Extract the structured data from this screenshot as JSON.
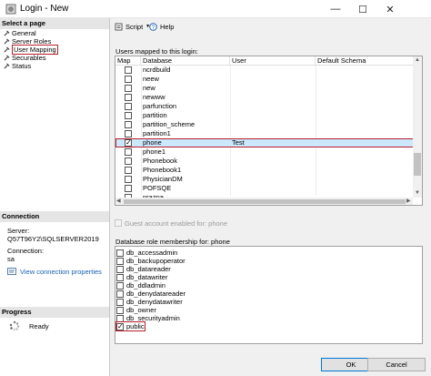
{
  "window": {
    "title": "Login - New",
    "controls": {
      "minimize": "—",
      "maximize": "☐",
      "close": "✕"
    }
  },
  "left": {
    "select_page_header": "Select a page",
    "pages": [
      {
        "label": "General"
      },
      {
        "label": "Server Roles"
      },
      {
        "label": "User Mapping"
      },
      {
        "label": "Securables"
      },
      {
        "label": "Status"
      }
    ],
    "connection_header": "Connection",
    "server_label": "Server:",
    "server_value": "Q57T96Y2\\SQLSERVER2019",
    "connection_label": "Connection:",
    "connection_value": "sa",
    "view_connection_link": "View connection properties",
    "progress_header": "Progress",
    "progress_status": "Ready"
  },
  "toolbar": {
    "script_label": "Script",
    "help_label": "Help"
  },
  "users_mapped": {
    "label": "Users mapped to this login:",
    "columns": [
      "Map",
      "Database",
      "User",
      "Default Schema"
    ],
    "rows": [
      {
        "map": false,
        "database": "ncrdbuild",
        "user": "",
        "schema": ""
      },
      {
        "map": false,
        "database": "neew",
        "user": "",
        "schema": ""
      },
      {
        "map": false,
        "database": "new",
        "user": "",
        "schema": ""
      },
      {
        "map": false,
        "database": "newww",
        "user": "",
        "schema": ""
      },
      {
        "map": false,
        "database": "parfunction",
        "user": "",
        "schema": ""
      },
      {
        "map": false,
        "database": "partition",
        "user": "",
        "schema": ""
      },
      {
        "map": false,
        "database": "partition_scheme",
        "user": "",
        "schema": ""
      },
      {
        "map": false,
        "database": "partition1",
        "user": "",
        "schema": ""
      },
      {
        "map": true,
        "database": "phone",
        "user": "Test",
        "schema": ""
      },
      {
        "map": false,
        "database": "phone1",
        "user": "",
        "schema": ""
      },
      {
        "map": false,
        "database": "Phonebook",
        "user": "",
        "schema": ""
      },
      {
        "map": false,
        "database": "Phonebook1",
        "user": "",
        "schema": ""
      },
      {
        "map": false,
        "database": "PhysicianDM",
        "user": "",
        "schema": ""
      },
      {
        "map": false,
        "database": "POFSQE",
        "user": "",
        "schema": ""
      },
      {
        "map": false,
        "database": "prazna",
        "user": "",
        "schema": ""
      }
    ],
    "selected_row": 8
  },
  "guest": {
    "label": "Guest account enabled for: phone"
  },
  "roles": {
    "label": "Database role membership for: phone",
    "items": [
      {
        "name": "db_accessadmin",
        "checked": false
      },
      {
        "name": "db_backupoperator",
        "checked": false
      },
      {
        "name": "db_datareader",
        "checked": false
      },
      {
        "name": "db_datawriter",
        "checked": false
      },
      {
        "name": "db_ddladmin",
        "checked": false
      },
      {
        "name": "db_denydatareader",
        "checked": false
      },
      {
        "name": "db_denydatawriter",
        "checked": false
      },
      {
        "name": "db_owner",
        "checked": false
      },
      {
        "name": "db_securityadmin",
        "checked": false
      },
      {
        "name": "public",
        "checked": true
      }
    ]
  },
  "buttons": {
    "ok": "OK",
    "cancel": "Cancel"
  },
  "colors": {
    "highlight_outline": "#b7202a",
    "selected_row": "#cce8ff",
    "link": "#1a5fb4",
    "ok_border": "#0078d7"
  }
}
